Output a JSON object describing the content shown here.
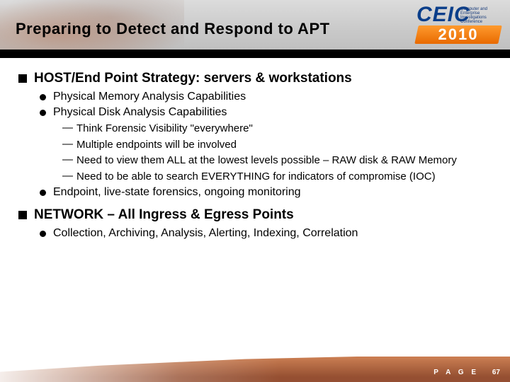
{
  "header": {
    "title": "Preparing to Detect and Respond to APT"
  },
  "logo": {
    "brand": "CEIC",
    "sub": "Computer and Enterprise Investigations Conference",
    "year": "2010"
  },
  "body": {
    "sections": [
      {
        "title": "HOST/End Point Strategy: servers & workstations",
        "items": [
          {
            "text": "Physical Memory Analysis Capabilities",
            "sub": []
          },
          {
            "text": "Physical Disk Analysis Capabilities",
            "sub": [
              "Think Forensic Visibility \"everywhere\"",
              "Multiple endpoints will be involved",
              "Need to view them ALL at the lowest levels possible – RAW disk & RAW Memory",
              "Need to be able to search EVERYTHING for indicators of compromise (IOC)"
            ]
          },
          {
            "text": "Endpoint, live-state forensics, ongoing monitoring",
            "sub": []
          }
        ]
      },
      {
        "title": "NETWORK – All Ingress & Egress Points",
        "items": [
          {
            "text": "Collection, Archiving, Analysis, Alerting, Indexing, Correlation",
            "sub": []
          }
        ]
      }
    ]
  },
  "footer": {
    "page_label": "P A G E",
    "page_num": "67"
  }
}
